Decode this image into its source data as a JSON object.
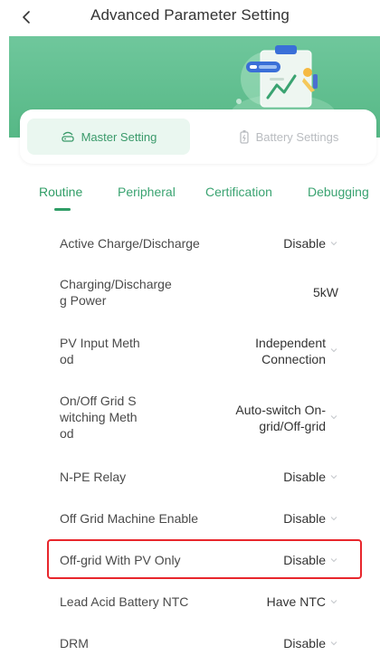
{
  "header": {
    "title": "Advanced Parameter Setting",
    "back_icon": "chevron-left-icon"
  },
  "colors": {
    "accent": "#2f9d66",
    "hero": "#5cbd8b",
    "highlight_box": "#e8262c",
    "inactive_text": "#b9bcc0"
  },
  "setting_tabs": [
    {
      "label": "Master Setting",
      "icon": "router-icon",
      "active": true
    },
    {
      "label": "Battery Settings",
      "icon": "battery-icon",
      "active": false
    }
  ],
  "sub_tabs": [
    {
      "label": "Routine",
      "active": true
    },
    {
      "label": "Peripheral",
      "active": false
    },
    {
      "label": "Certification",
      "active": false
    },
    {
      "label": "Debugging",
      "active": false
    }
  ],
  "rows": [
    {
      "label": "Active Charge/Discharge",
      "value": "Disable",
      "has_arrow": true
    },
    {
      "label": "Charging/Discharging Power",
      "label_display": "Charging/Discharge\ng Power",
      "value": "5kW",
      "has_arrow": false
    },
    {
      "label": "PV Input Method",
      "label_display": "PV Input Meth\nod",
      "value": "Independent\nConnection",
      "has_arrow": true
    },
    {
      "label": "On/Off Grid Switching Method",
      "label_display": "On/Off Grid S\nwitching Meth\nod",
      "value": "Auto-switch On-\ngrid/Off-grid",
      "has_arrow": true
    },
    {
      "label": "N-PE Relay",
      "value": "Disable",
      "has_arrow": true
    },
    {
      "label": "Off Grid Machine Enable",
      "value": "Disable",
      "has_arrow": true
    },
    {
      "label": "Off-grid With PV Only",
      "value": "Disable",
      "has_arrow": true,
      "highlighted": true
    },
    {
      "label": "Lead Acid Battery NTC",
      "value": "Have NTC",
      "has_arrow": true
    },
    {
      "label": "DRM",
      "value": "Disable",
      "has_arrow": true
    }
  ]
}
